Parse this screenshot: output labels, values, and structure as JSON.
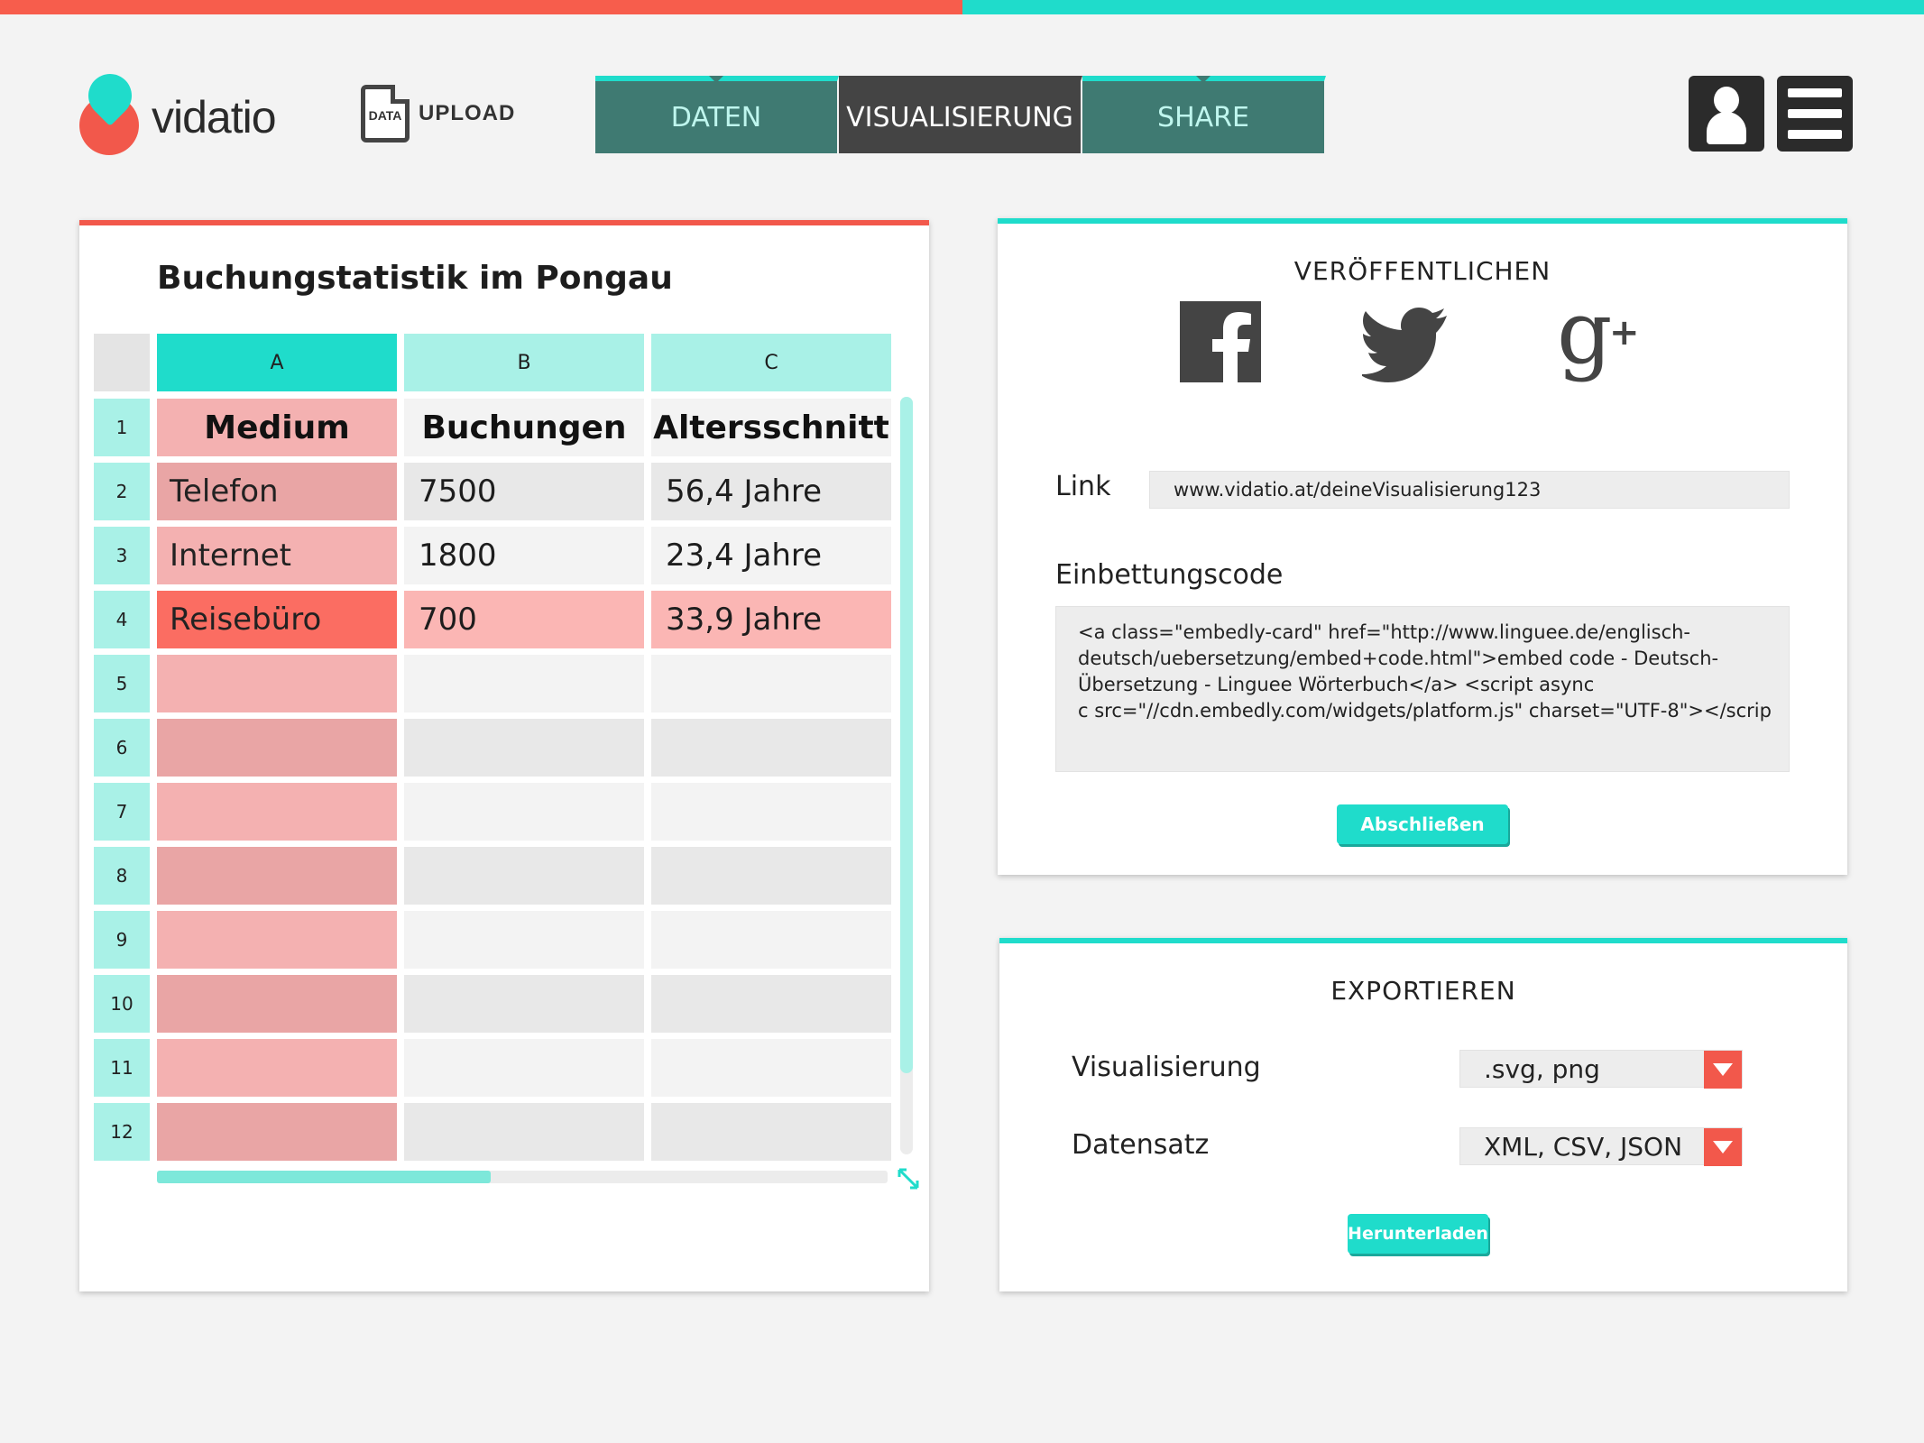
{
  "brand": {
    "name": "vidatio"
  },
  "upload": {
    "icon_text": "DATA",
    "label": "UPLOAD"
  },
  "tabs": [
    {
      "label": "DATEN",
      "active": false
    },
    {
      "label": "VISUALISIERUNG",
      "active": true
    },
    {
      "label": "SHARE",
      "active": false
    }
  ],
  "header_icons": {
    "user": "user-icon",
    "menu": "hamburger-menu-icon"
  },
  "colors": {
    "coral": "#f2584b",
    "teal": "#1fdccb",
    "teal_dark": "#3f7a72",
    "teal_light": "#a9f1e7"
  },
  "sheet": {
    "title": "Buchungstatistik im Pongau",
    "columns": [
      "A",
      "B",
      "C"
    ],
    "rows": [
      {
        "num": "1",
        "cells": [
          "Medium",
          "Buchungen",
          "Altersschnitt"
        ]
      },
      {
        "num": "2",
        "cells": [
          "Telefon",
          "7500",
          "56,4 Jahre"
        ]
      },
      {
        "num": "3",
        "cells": [
          "Internet",
          "1800",
          "23,4 Jahre"
        ]
      },
      {
        "num": "4",
        "cells": [
          "Reisebüro",
          "700",
          "33,9 Jahre"
        ]
      },
      {
        "num": "5",
        "cells": [
          "",
          "",
          ""
        ]
      },
      {
        "num": "6",
        "cells": [
          "",
          "",
          ""
        ]
      },
      {
        "num": "7",
        "cells": [
          "",
          "",
          ""
        ]
      },
      {
        "num": "8",
        "cells": [
          "",
          "",
          ""
        ]
      },
      {
        "num": "9",
        "cells": [
          "",
          "",
          ""
        ]
      },
      {
        "num": "10",
        "cells": [
          "",
          "",
          ""
        ]
      },
      {
        "num": "11",
        "cells": [
          "",
          "",
          ""
        ]
      },
      {
        "num": "12",
        "cells": [
          "",
          "",
          ""
        ]
      }
    ]
  },
  "publish": {
    "title": "VERÖFFENTLICHEN",
    "social": [
      "facebook-icon",
      "twitter-icon",
      "google-plus-icon"
    ],
    "link_label": "Link",
    "link_value": "www.vidatio.at/deineVisualisierung123",
    "embed_label": "Einbettungscode",
    "embed_lines": [
      "<a class=\"embedly-card\" href=\"http://www.linguee.de/englisch-",
      "deutsch/uebersetzung/embed+code.html\">embed code - Deutsch-",
      "Übersetzung - Linguee Wörterbuch</a> <script async",
      "c src=\"//cdn.embedly.com/widgets/platform.js\" charset=\"UTF-8\"></scrip"
    ],
    "close_button": "Abschließen"
  },
  "export": {
    "title": "EXPORTIEREN",
    "vis_label": "Visualisierung",
    "vis_value": ".svg, png",
    "data_label": "Datensatz",
    "data_value": "XML, CSV, JSON",
    "download_button": "Herunterladen"
  }
}
